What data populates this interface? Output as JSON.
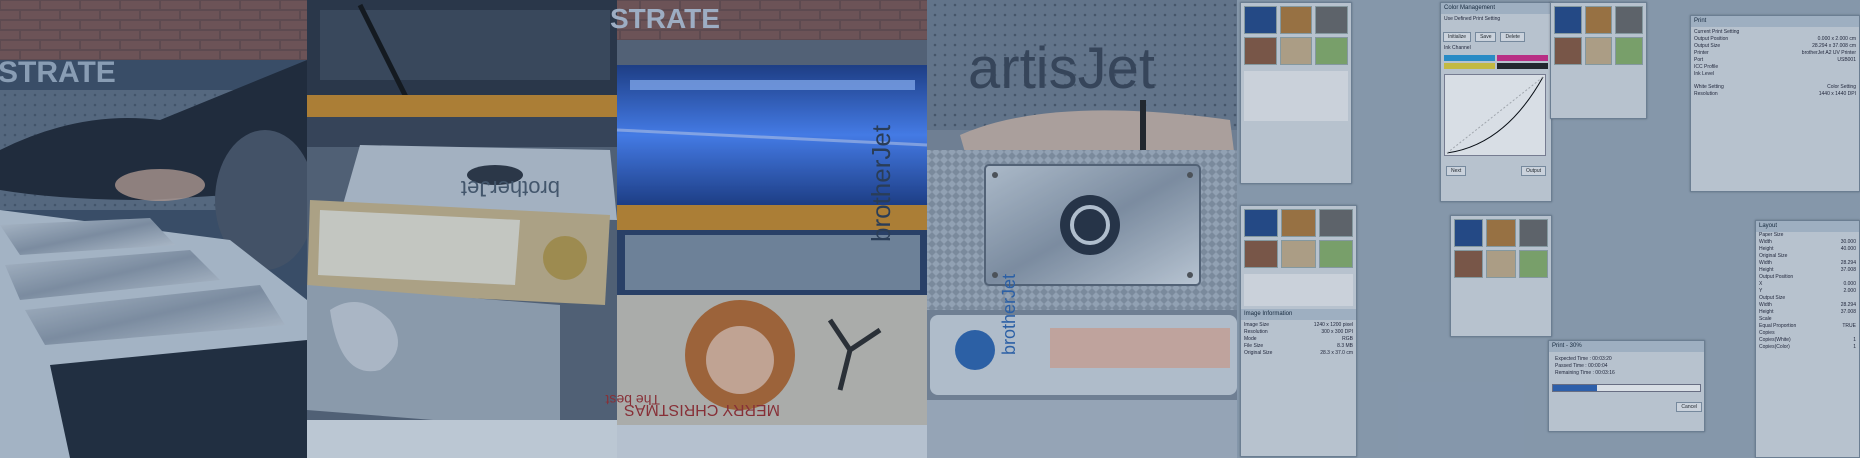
{
  "brand": {
    "wall_text_1": "STRATE",
    "wall_text_2": "STRATE",
    "plate_logo": "artisJet",
    "plate_sub": "brotherJet",
    "xmas": "MERRY CHRISTMAS",
    "xmas2": "The best"
  },
  "colors": {
    "tint": "#2c4a6e",
    "printer_orange": "#c98a2a",
    "uv_blue": "#3c7cff",
    "ui_panel": "#d7dde3",
    "progress": "#2f64b8"
  },
  "software": {
    "color_mgmt_title": "Color Management",
    "print_setting_title": "Use Defined Print Setting",
    "image_info_title": "Image Information",
    "image_info": [
      [
        "Image Size",
        "1240 x 1200 pixel"
      ],
      [
        "Resolution",
        "300 x 300 DPI"
      ],
      [
        "Mode",
        "RGB"
      ],
      [
        "File Size",
        "8.3 MB"
      ],
      [
        "Original Size",
        "28.3 x 37.0 cm"
      ]
    ],
    "print_title": "Print",
    "print_fields": [
      [
        "Current Print Setting",
        ""
      ],
      [
        "Output Position",
        "0.000 x 2.000 cm"
      ],
      [
        "Output Size",
        "28.294 x 37.008 cm"
      ],
      [
        "Printer",
        "brotherJet A2 UV Printer"
      ],
      [
        "Port",
        "USB001"
      ],
      [
        "ICC Profile",
        ""
      ],
      [
        "Ink Level",
        ""
      ]
    ],
    "white_setting": "White Setting",
    "color_setting": "Color Setting",
    "resolution": "Resolution",
    "resolution_value": "1440 x 1440 DPI",
    "layout_title": "Layout",
    "layout_fields": [
      [
        "Paper Size",
        ""
      ],
      [
        "Width",
        "30.000"
      ],
      [
        "Height",
        "40.000"
      ],
      [
        "Original Size",
        ""
      ],
      [
        "Width",
        "28.294"
      ],
      [
        "Height",
        "37.008"
      ],
      [
        "Output Position",
        ""
      ],
      [
        "X",
        "0.000"
      ],
      [
        "Y",
        "2.000"
      ],
      [
        "Output Size",
        ""
      ],
      [
        "Width",
        "28.294"
      ],
      [
        "Height",
        "37.008"
      ],
      [
        "Scale",
        ""
      ],
      [
        "Equal Proportion",
        "TRUE"
      ],
      [
        "Copies",
        ""
      ],
      [
        "Copies(White)",
        "1"
      ],
      [
        "Copies(Color)",
        "1"
      ]
    ],
    "progress_title": "Print - 30%",
    "progress_fraction": 0.3,
    "expected_time": "Expected Time : 00:03:20",
    "passed_time": "Passed Time : 00:00:04",
    "remaining_time": "Remaining Time : 00:03:16",
    "cancel_label": "Cancel",
    "buttons": [
      "Initialize",
      "Save",
      "Delete"
    ],
    "ink_channel": "Ink Channel",
    "next_label": "Next",
    "output_label": "Output"
  }
}
